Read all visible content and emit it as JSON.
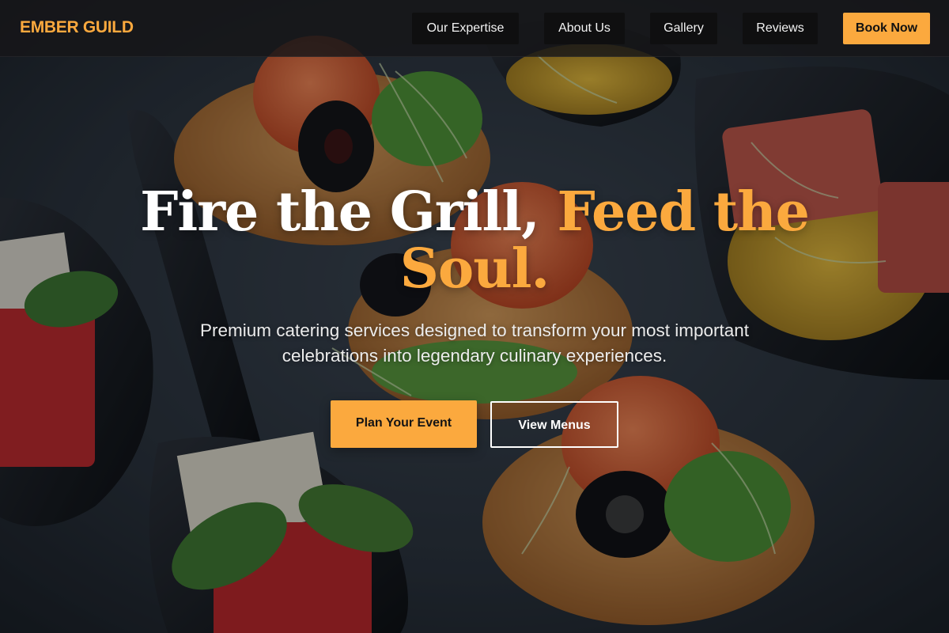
{
  "brand": {
    "name": "EMBER GUILD",
    "color": "#fba93e"
  },
  "nav": {
    "links": [
      {
        "label": "Our Expertise"
      },
      {
        "label": "About Us"
      },
      {
        "label": "Gallery"
      },
      {
        "label": "Reviews"
      }
    ],
    "cta_label": "Book Now"
  },
  "hero": {
    "title_part1": "Fire the Grill, ",
    "title_part2": "Feed the Soul.",
    "subtitle_line1": "Premium catering services designed to transform your most important",
    "subtitle_line2": "celebrations into legendary culinary experiences.",
    "primary_button": "Plan Your Event",
    "secondary_button": "View Menus",
    "background_image": "catering appetizers on slate (salmon canapés, olives, watermelon-feta spoons, microgreens)"
  },
  "colors": {
    "accent": "#fba93e",
    "header_bg": "#161618",
    "nav_button_bg": "#0f0f10",
    "text_light": "#ffffff"
  }
}
